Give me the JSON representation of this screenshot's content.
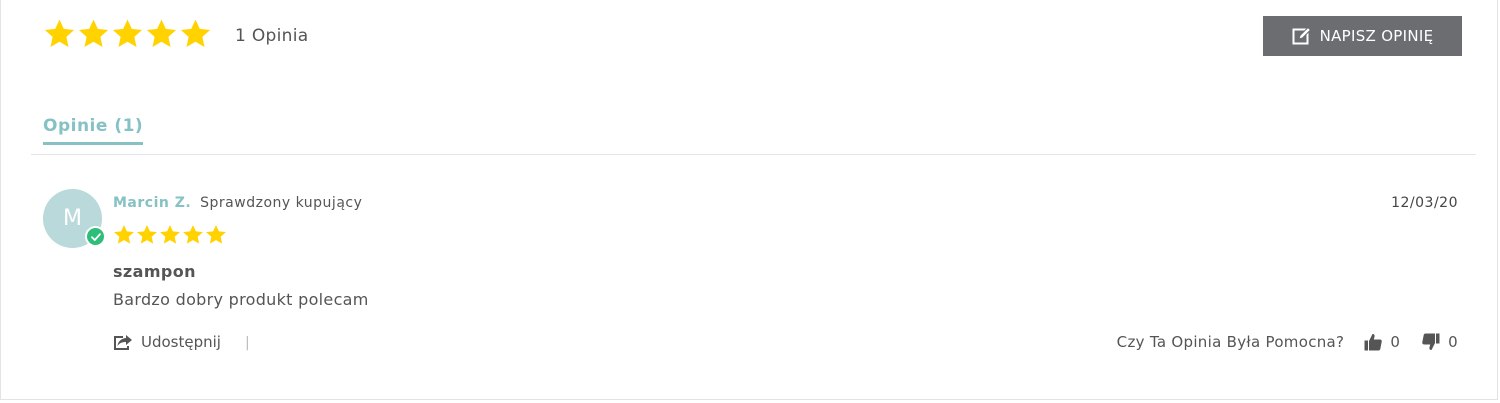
{
  "summary": {
    "rating": 5,
    "max_rating": 5,
    "count_label": "1 Opinia",
    "star_color": "#ffd200"
  },
  "write_review": {
    "label": "NAPISZ OPINIĘ",
    "icon": "edit-icon"
  },
  "tabs": [
    {
      "label": "Opinie (1)",
      "active": true
    }
  ],
  "reviews": [
    {
      "avatar_initial": "M",
      "author": "Marcin Z.",
      "badge": "Sprawdzony kupujący",
      "verified_icon": "check-icon",
      "date": "12/03/20",
      "rating": 5,
      "title": "szampon",
      "body": "Bardzo dobry produkt polecam",
      "share_label": "Udostępnij",
      "share_separator": "|",
      "helpful_question": "Czy Ta Opinia Była Pomocna?",
      "thumbs_up_count": "0",
      "thumbs_down_count": "0"
    }
  ],
  "colors": {
    "accent": "#86c1c4",
    "button_bg": "#6b6d71",
    "verified": "#2fbe7a",
    "avatar_bg": "#b9d9db"
  }
}
